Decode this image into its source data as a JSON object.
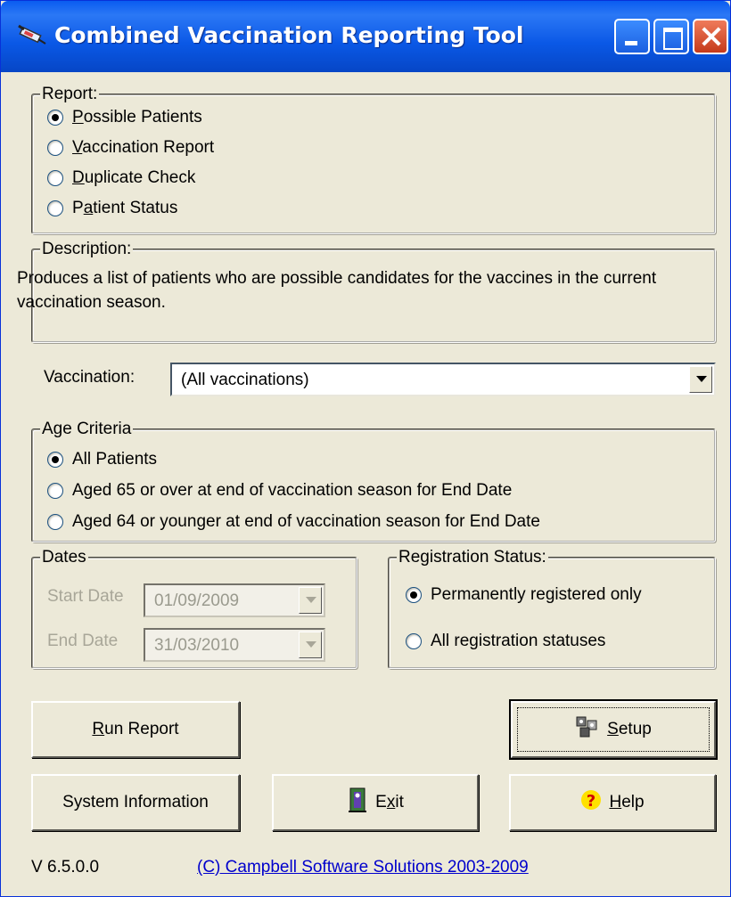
{
  "window": {
    "title": "Combined Vaccination Reporting Tool",
    "icon": "syringe-icon"
  },
  "report": {
    "legend": "Report:",
    "options": [
      {
        "label_pre": "",
        "label_u": "P",
        "label_post": "ossible Patients",
        "checked": true
      },
      {
        "label_pre": "",
        "label_u": "V",
        "label_post": "accination Report",
        "checked": false
      },
      {
        "label_pre": "",
        "label_u": "D",
        "label_post": "uplicate Check",
        "checked": false
      },
      {
        "label_pre": "P",
        "label_u": "a",
        "label_post": "tient Status",
        "checked": false
      }
    ]
  },
  "description": {
    "legend": "Description:",
    "text": "Produces a list of patients who are possible candidates for the vaccines in the current vaccination season."
  },
  "vaccination": {
    "label": "Vaccination:",
    "value": "(All vaccinations)"
  },
  "age": {
    "legend": "Age Criteria",
    "options": [
      {
        "label": "All Patients",
        "checked": true
      },
      {
        "label": "Aged 65 or over at end of vaccination season for End Date",
        "checked": false
      },
      {
        "label": "Aged 64 or younger at end of vaccination season for End Date",
        "checked": false
      }
    ]
  },
  "dates": {
    "legend": "Dates",
    "start_label": "Start Date",
    "start_value": "01/09/2009",
    "end_label": "End Date",
    "end_value": "31/03/2010"
  },
  "registration": {
    "legend": "Registration Status:",
    "options": [
      {
        "label": "Permanently registered only",
        "checked": true
      },
      {
        "label": "All registration statuses",
        "checked": false
      }
    ]
  },
  "buttons": {
    "run_u": "R",
    "run_rest": "un Report",
    "setup_u": "S",
    "setup_rest": "etup",
    "sysinfo": "System Information",
    "exit_pre": "E",
    "exit_u": "x",
    "exit_rest": "it",
    "help_u": "H",
    "help_rest": "elp"
  },
  "footer": {
    "version": "V 6.5.0.0",
    "copyright": "(C) Campbell Software Solutions 2003-2009"
  }
}
